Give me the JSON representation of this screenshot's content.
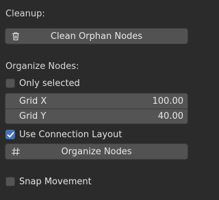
{
  "cleanup": {
    "heading": "Cleanup:",
    "clean_button_label": "Clean Orphan Nodes"
  },
  "organize": {
    "heading": "Organize Nodes:",
    "only_selected_label": "Only selected",
    "only_selected_checked": false,
    "grid_x": {
      "label": "Grid X",
      "value": "100.00"
    },
    "grid_y": {
      "label": "Grid Y",
      "value": "40.00"
    },
    "use_connection_layout_label": "Use Connection Layout",
    "use_connection_layout_checked": true,
    "organize_button_label": "Organize Nodes"
  },
  "snap": {
    "snap_movement_label": "Snap Movement",
    "snap_movement_checked": false
  },
  "icons": {
    "clean": "trash-icon",
    "organize": "grid-icon",
    "check": "checkmark-icon"
  },
  "colors": {
    "background": "#2b2b2b",
    "button": "#525252",
    "field": "#545454",
    "checkbox_checked": "#4772b3"
  }
}
